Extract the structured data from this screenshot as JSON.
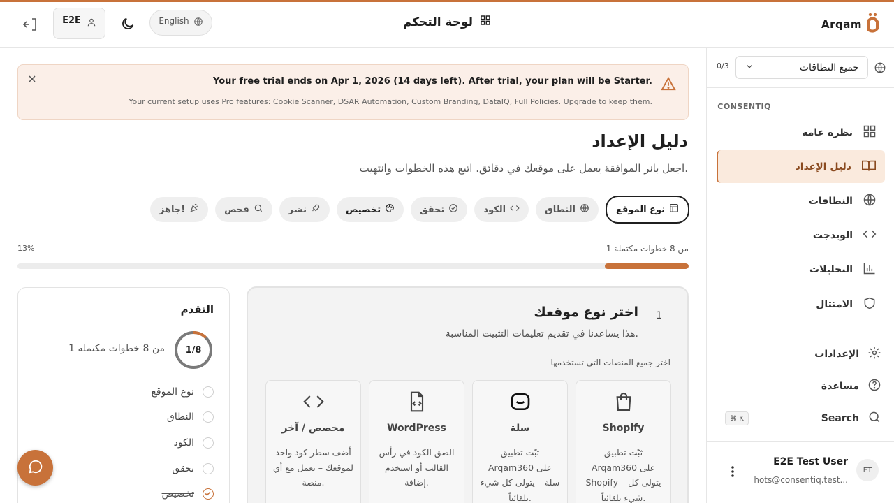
{
  "header": {
    "title": "لوحة التحكم",
    "user_chip": "E2E",
    "language": "English",
    "logo_text": "Arqam"
  },
  "sidebar": {
    "domain_count": "0/3",
    "domain_select": "جميع النطاقات",
    "section": "CONSENTIQ",
    "items": [
      {
        "label": "نظرة عامة",
        "icon": "grid-icon"
      },
      {
        "label": "دليل الإعداد",
        "icon": "book-icon",
        "active": true
      },
      {
        "label": "النطاقات",
        "icon": "globe-icon"
      },
      {
        "label": "الويدجت",
        "icon": "code-icon"
      },
      {
        "label": "التحليلات",
        "icon": "bar-chart-icon"
      },
      {
        "label": "الامتثال",
        "icon": "shield-icon"
      }
    ],
    "bottom": {
      "settings": "الإعدادات",
      "help": "مساعدة",
      "search": "Search",
      "shortcut": "⌘ K"
    },
    "user": {
      "initials": "ET",
      "name": "E2E Test User",
      "email": "hots@consentiq.test..."
    }
  },
  "banner": {
    "title": "Your free trial ends on Apr 1, 2026 (14 days left). After trial, your plan will be Starter.",
    "body": "Your current setup uses Pro features: Cookie Scanner, DSAR Automation, Custom Branding, DataIQ, Full Policies. Upgrade to keep them."
  },
  "main": {
    "title": "دليل الإعداد",
    "subtitle": "اجعل بانر الموافقة يعمل على موقعك في دقائق. اتبع هذه الخطوات وانتهيت.",
    "steps": [
      {
        "label": "نوع الموقع",
        "icon": "layout-icon",
        "state": "current"
      },
      {
        "label": "النطاق",
        "icon": "globe-icon",
        "state": "todo"
      },
      {
        "label": "الكود",
        "icon": "code-icon",
        "state": "todo"
      },
      {
        "label": "تحقق",
        "icon": "check-circle-icon",
        "state": "todo"
      },
      {
        "label": "تخصيص",
        "icon": "palette-icon",
        "state": "strong"
      },
      {
        "label": "نشر",
        "icon": "rocket-icon",
        "state": "todo"
      },
      {
        "label": "فحص",
        "icon": "search-icon",
        "state": "todo"
      },
      {
        "label": "جاهز!",
        "icon": "party-icon",
        "state": "todo"
      }
    ],
    "progress_text": "1 من 8 خطوات مكتملة",
    "progress_percent": "13%",
    "progress_fraction": 0.125
  },
  "card": {
    "number": "1",
    "title": "اختر نوع موقعك",
    "description": "هذا يساعدنا في تقديم تعليمات التثبيت المناسبة.",
    "pick_label": "اختر جميع المنصات التي تستخدمها",
    "platforms": [
      {
        "name": "Shopify",
        "desc": "ثبّت تطبيق Arqam360 على Shopify – يتولى كل شيء تلقائياً.",
        "icon": "shopping-bag-icon"
      },
      {
        "name": "سلة",
        "desc": "ثبّت تطبيق Arqam360 على سلة – يتولى كل شيء تلقائياً.",
        "icon": "salla-icon"
      },
      {
        "name": "WordPress",
        "desc": "الصق الكود في رأس القالب أو استخدم إضافة.",
        "icon": "file-code-icon"
      },
      {
        "name": "مخصص / آخر",
        "desc": "أضف سطر كود واحد لموقعك – يعمل مع أي منصة.",
        "icon": "code-icon"
      }
    ]
  },
  "panel": {
    "title": "التقدم",
    "ring_label": "1/8",
    "ring_fraction": 0.125,
    "summary": "1 من 8 خطوات مكتملة",
    "steps": [
      {
        "label": "نوع الموقع",
        "done": false
      },
      {
        "label": "النطاق",
        "done": false
      },
      {
        "label": "الكود",
        "done": false
      },
      {
        "label": "تحقق",
        "done": false
      },
      {
        "label": "تخصيص",
        "done": true
      }
    ]
  },
  "colors": {
    "accent": "#c8723a",
    "active_bg": "#faeadd",
    "banner_bg": "#fbefe8"
  }
}
